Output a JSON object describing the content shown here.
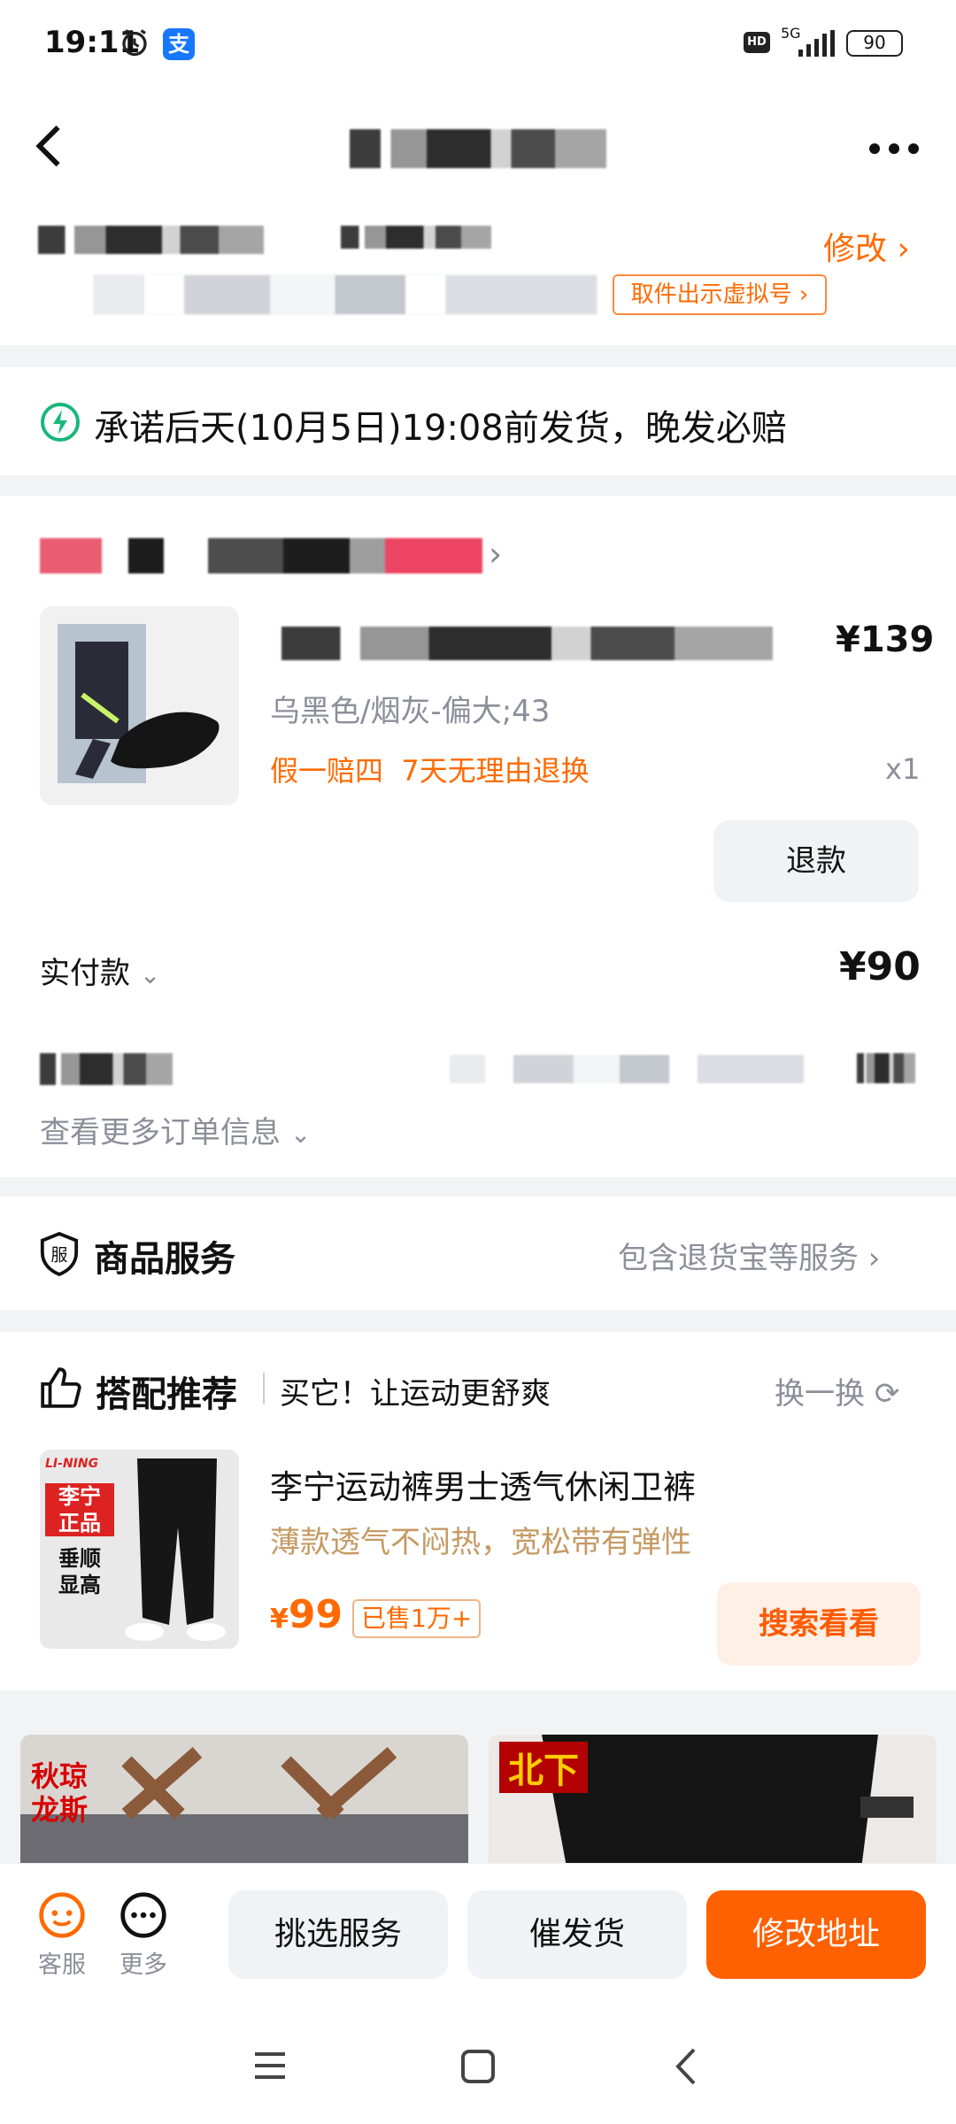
{
  "status_bar": {
    "time": "19:11",
    "network": "5G",
    "battery": "90"
  },
  "header": {
    "title_redacted": true
  },
  "address": {
    "edit_label": "修改",
    "pickup_label": "取件出示虚拟号"
  },
  "promise": {
    "text": "承诺后天(10月5日)19:08前发货，晚发必赔"
  },
  "order": {
    "price": "¥139",
    "variant": "乌黑色/烟灰-偏大;43",
    "tags": "假一赔四  7天无理由退换",
    "qty": "x1",
    "refund_button": "退款",
    "paid_label": "实付款",
    "paid_amount": "¥90",
    "more_info": "查看更多订单信息"
  },
  "service": {
    "title": "商品服务",
    "desc": "包含退货宝等服务"
  },
  "recommend": {
    "title": "搭配推荐",
    "subtitle": "买它！让运动更舒爽",
    "refresh": "换一换",
    "product": {
      "name": "李宁运动裤男士透气休闲卫裤",
      "desc": "薄款透气不闷热，宽松带有弹性",
      "price": "99",
      "currency": "¥",
      "sold": "已售1万+",
      "search_button": "搜索看看",
      "image_text": [
        "李宁",
        "正品",
        "垂顺",
        "显高"
      ]
    },
    "card_left_text": [
      "秋",
      "琼",
      "龙",
      "斯"
    ],
    "card_right_text": "北下"
  },
  "bottom_bar": {
    "service_label": "客服",
    "more_label": "更多",
    "pick_service": "挑选服务",
    "urge_ship": "催发货",
    "modify_address": "修改地址"
  },
  "colors": {
    "accent": "#ff6a00",
    "bg": "#f2f3f5",
    "muted": "#8a8f99"
  }
}
